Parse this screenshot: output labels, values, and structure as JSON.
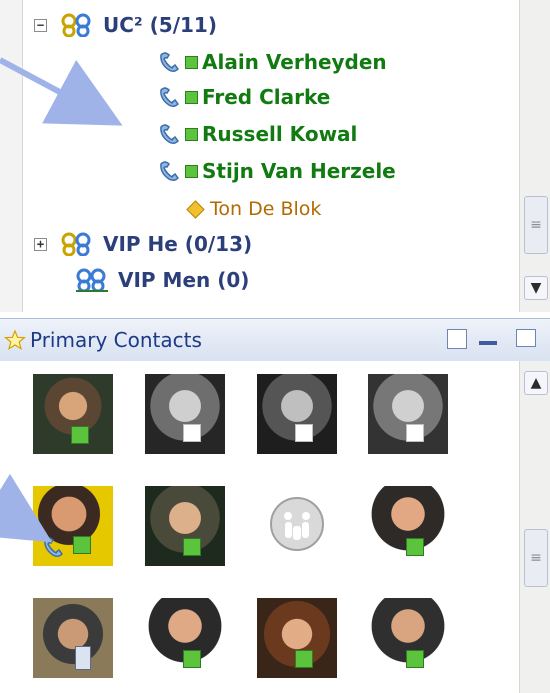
{
  "tree": {
    "groups": [
      {
        "label": "UC² (5/11)",
        "expander": "−"
      },
      {
        "label": "VIP He (0/13)",
        "expander": "+"
      },
      {
        "label": "VIP Men (0)",
        "expander": ""
      }
    ],
    "contacts": [
      {
        "name": "Alain Verheyden"
      },
      {
        "name": "Fred Clarke"
      },
      {
        "name": "Russell Kowal"
      },
      {
        "name": "Stijn Van Herzele"
      }
    ],
    "offline": {
      "name": "Ton De Blok"
    }
  },
  "panel": {
    "title": "Primary Contacts",
    "icons": [
      "star-icon",
      "contact-card-icon",
      "minimize-icon",
      "maximize-icon"
    ]
  },
  "colors": {
    "online": "#117a11",
    "group": "#2b3f7a",
    "offline": "#b36a00",
    "header_bg": "#dfe6f3"
  },
  "avatars": [
    {
      "status": "green-square"
    },
    {
      "status": "white-square"
    },
    {
      "status": "white-square"
    },
    {
      "status": "white-square"
    },
    {
      "status": "phone-busy"
    },
    {
      "status": "green-square"
    },
    {
      "status": "generic-placeholder"
    },
    {
      "status": "green-square"
    },
    {
      "status": "mobile"
    },
    {
      "status": "green-square"
    },
    {
      "status": "green-square"
    },
    {
      "status": "green-square"
    }
  ]
}
